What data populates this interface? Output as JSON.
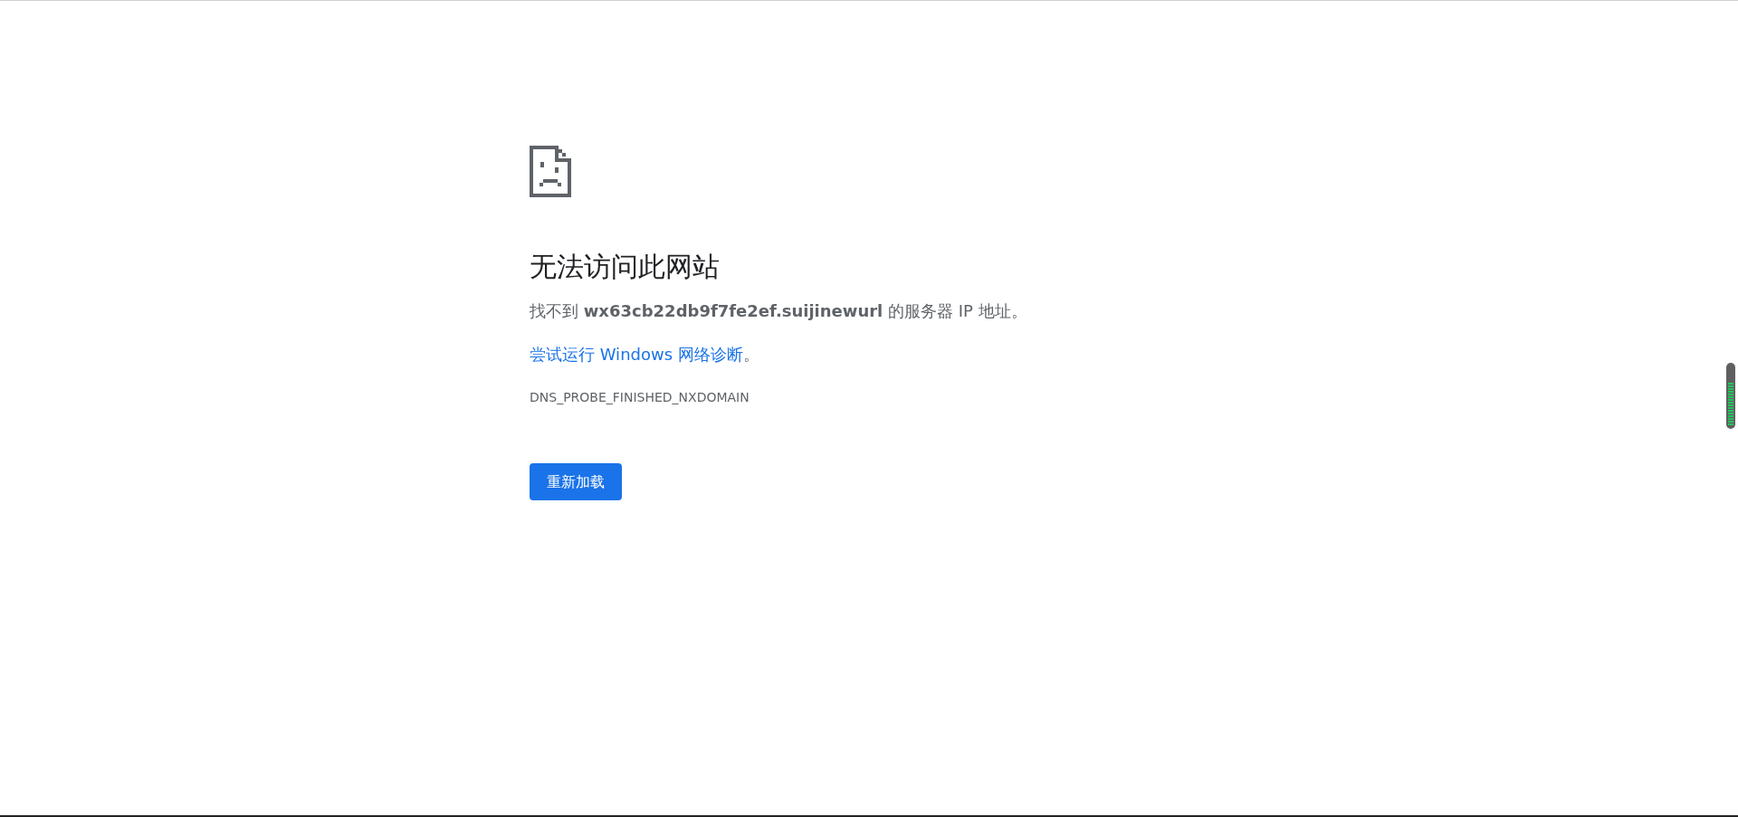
{
  "title": "无法访问此网站",
  "summary": "找不到 **wx63cb22db9f7fe2ef.suijinewurl** 的服务器 IP 地址。",
  "suggestion": {
    "link": "尝试运行 Windows 网络诊断",
    "suffix": "。"
  },
  "error_code": "DNS_PROBE_FINISHED_NXDOMAIN",
  "buttons": [
    "重新加载"
  ]
}
